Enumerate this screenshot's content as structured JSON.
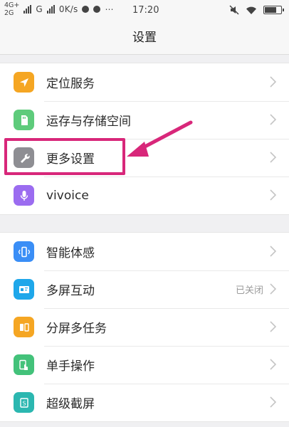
{
  "status_bar": {
    "network_top": "4G+",
    "network_bottom": "2G",
    "carrier": "G",
    "speed": "0K/s",
    "time": "17:20",
    "battery_level": 0.75
  },
  "header": {
    "title": "设置"
  },
  "groups": [
    {
      "items": [
        {
          "label": "定位服务",
          "icon": "location-icon",
          "color": "#f5a623"
        },
        {
          "label": "运存与存储空间",
          "icon": "storage-icon",
          "color": "#5ecb7b"
        },
        {
          "label": "更多设置",
          "icon": "wrench-icon",
          "color": "#8e8e93"
        },
        {
          "label": "vivoice",
          "icon": "microphone-icon",
          "color": "#9b6cf0"
        }
      ]
    },
    {
      "items": [
        {
          "label": "智能体感",
          "icon": "phone-motion-icon",
          "color": "#3a8ef6"
        },
        {
          "label": "多屏互动",
          "icon": "screen-cast-icon",
          "color": "#1ea7ea",
          "value": "已关闭"
        },
        {
          "label": "分屏多任务",
          "icon": "split-screen-icon",
          "color": "#f5a623"
        },
        {
          "label": "单手操作",
          "icon": "one-hand-icon",
          "color": "#43c27a"
        },
        {
          "label": "超级截屏",
          "icon": "screenshot-icon",
          "color": "#2bb7b0"
        }
      ]
    }
  ],
  "colors": {
    "highlight": "#d8277a",
    "chevron": "#c4c4c4"
  }
}
